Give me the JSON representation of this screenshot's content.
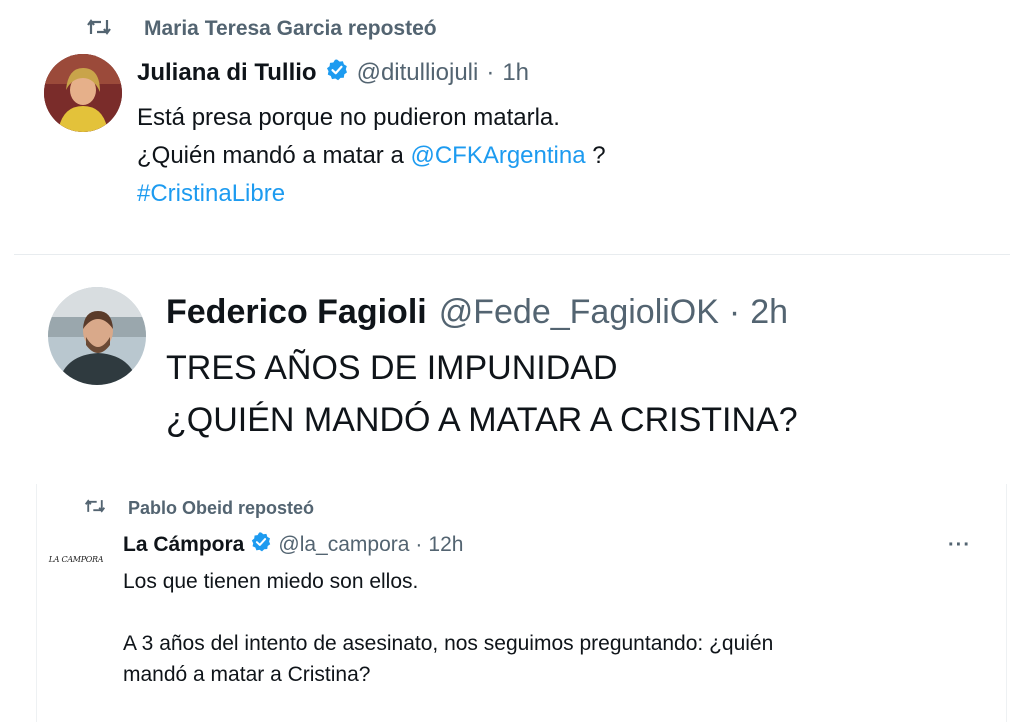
{
  "tweet1": {
    "repost_label": "Maria Teresa Garcia reposteó",
    "author_name": "Juliana di Tullio",
    "handle": "@ditulliojuli",
    "separator": "·",
    "time": "1h",
    "line1": "Está presa porque no pudieron matarla.",
    "line2_prefix": "¿Quién mandó a matar a ",
    "mention": "@CFKArgentina",
    "line2_suffix": " ?",
    "hashtag": "#CristinaLibre",
    "verified": true
  },
  "tweet2": {
    "author_name": "Federico Fagioli",
    "handle": "@Fede_FagioliOK",
    "separator": "·",
    "time": "2h",
    "line1": "TRES AÑOS DE IMPUNIDAD",
    "line2": "¿QUIÉN MANDÓ A MATAR A CRISTINA?"
  },
  "tweet3": {
    "repost_label": "Pablo Obeid reposteó",
    "author_name": "La Cámpora",
    "avatar_text": "LA CAMPORA",
    "handle": "@la_campora",
    "separator": "·",
    "time": "12h",
    "more_label": "···",
    "line1": "Los que tienen miedo son ellos.",
    "line2": "A 3 años del intento de asesinato, nos seguimos preguntando: ¿quién",
    "line3": "mandó a matar a Cristina?",
    "verified": true
  },
  "colors": {
    "text": "#0f1419",
    "muted": "#536471",
    "link": "#1d9bf0",
    "verified_badge": "#1d9bf0",
    "divider": "#e8ecef"
  },
  "icons": {
    "repost": "repost-icon",
    "verified": "verified-badge-icon",
    "more": "more-icon"
  }
}
